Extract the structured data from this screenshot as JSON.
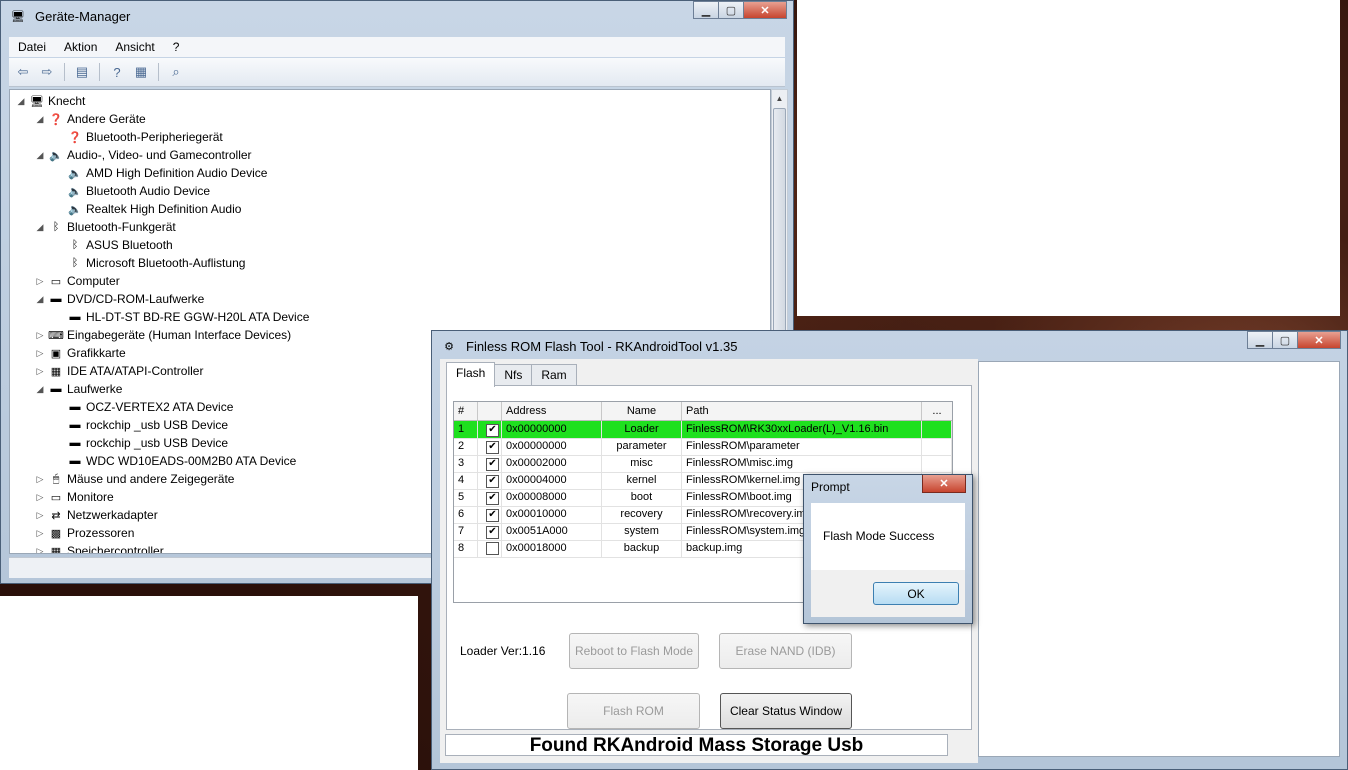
{
  "device_manager": {
    "title": "Geräte-Manager",
    "menu": [
      "Datei",
      "Aktion",
      "Ansicht",
      "?"
    ],
    "tree": [
      {
        "label": "Knecht",
        "level": 0,
        "expander": "◢",
        "icon": "computer-icon"
      },
      {
        "label": "Andere Geräte",
        "level": 1,
        "expander": "◢",
        "icon": "unknown-device-icon"
      },
      {
        "label": "Bluetooth-Peripheriegerät",
        "level": 2,
        "expander": "",
        "icon": "unknown-device-icon"
      },
      {
        "label": "Audio-, Video- und Gamecontroller",
        "level": 1,
        "expander": "◢",
        "icon": "speaker-icon"
      },
      {
        "label": "AMD High Definition Audio Device",
        "level": 2,
        "expander": "",
        "icon": "speaker-icon"
      },
      {
        "label": "Bluetooth Audio Device",
        "level": 2,
        "expander": "",
        "icon": "speaker-icon"
      },
      {
        "label": "Realtek High Definition Audio",
        "level": 2,
        "expander": "",
        "icon": "speaker-icon"
      },
      {
        "label": "Bluetooth-Funkgerät",
        "level": 1,
        "expander": "◢",
        "icon": "bluetooth-icon"
      },
      {
        "label": "ASUS Bluetooth",
        "level": 2,
        "expander": "",
        "icon": "bluetooth-icon"
      },
      {
        "label": "Microsoft Bluetooth-Auflistung",
        "level": 2,
        "expander": "",
        "icon": "bluetooth-icon"
      },
      {
        "label": "Computer",
        "level": 1,
        "expander": "▷",
        "icon": "monitor-icon"
      },
      {
        "label": "DVD/CD-ROM-Laufwerke",
        "level": 1,
        "expander": "◢",
        "icon": "drive-icon"
      },
      {
        "label": "HL-DT-ST BD-RE  GGW-H20L ATA Device",
        "level": 2,
        "expander": "",
        "icon": "drive-icon"
      },
      {
        "label": "Eingabegeräte (Human Interface Devices)",
        "level": 1,
        "expander": "▷",
        "icon": "hid-icon"
      },
      {
        "label": "Grafikkarte",
        "level": 1,
        "expander": "▷",
        "icon": "display-adapter-icon"
      },
      {
        "label": "IDE ATA/ATAPI-Controller",
        "level": 1,
        "expander": "▷",
        "icon": "controller-icon"
      },
      {
        "label": "Laufwerke",
        "level": 1,
        "expander": "◢",
        "icon": "drive-icon"
      },
      {
        "label": "OCZ-VERTEX2 ATA Device",
        "level": 2,
        "expander": "",
        "icon": "drive-icon"
      },
      {
        "label": "rockchip _usb USB Device",
        "level": 2,
        "expander": "",
        "icon": "drive-icon"
      },
      {
        "label": "rockchip _usb USB Device",
        "level": 2,
        "expander": "",
        "icon": "drive-icon"
      },
      {
        "label": "WDC WD10EADS-00M2B0 ATA Device",
        "level": 2,
        "expander": "",
        "icon": "drive-icon"
      },
      {
        "label": "Mäuse und andere Zeigegeräte",
        "level": 1,
        "expander": "▷",
        "icon": "mouse-icon"
      },
      {
        "label": "Monitore",
        "level": 1,
        "expander": "▷",
        "icon": "monitor-icon"
      },
      {
        "label": "Netzwerkadapter",
        "level": 1,
        "expander": "▷",
        "icon": "network-icon"
      },
      {
        "label": "Prozessoren",
        "level": 1,
        "expander": "▷",
        "icon": "cpu-icon"
      },
      {
        "label": "Speichercontroller",
        "level": 1,
        "expander": "▷",
        "icon": "controller-icon"
      }
    ]
  },
  "rktool": {
    "title": "Finless ROM Flash Tool - RKAndroidTool v1.35",
    "tabs": [
      "Flash",
      "Nfs",
      "Ram"
    ],
    "columns": [
      "#",
      "",
      "Address",
      "Name",
      "Path",
      "..."
    ],
    "rows": [
      {
        "num": "1",
        "checked": true,
        "address": "0x00000000",
        "name": "Loader",
        "path": "FinlessROM\\RK30xxLoader(L)_V1.16.bin",
        "highlight": true
      },
      {
        "num": "2",
        "checked": true,
        "address": "0x00000000",
        "name": "parameter",
        "path": "FinlessROM\\parameter",
        "highlight": false
      },
      {
        "num": "3",
        "checked": true,
        "address": "0x00002000",
        "name": "misc",
        "path": "FinlessROM\\misc.img",
        "highlight": false
      },
      {
        "num": "4",
        "checked": true,
        "address": "0x00004000",
        "name": "kernel",
        "path": "FinlessROM\\kernel.img",
        "highlight": false
      },
      {
        "num": "5",
        "checked": true,
        "address": "0x00008000",
        "name": "boot",
        "path": "FinlessROM\\boot.img",
        "highlight": false
      },
      {
        "num": "6",
        "checked": true,
        "address": "0x00010000",
        "name": "recovery",
        "path": "FinlessROM\\recovery.img",
        "highlight": false
      },
      {
        "num": "7",
        "checked": true,
        "address": "0x0051A000",
        "name": "system",
        "path": "FinlessROM\\system.img",
        "highlight": false
      },
      {
        "num": "8",
        "checked": false,
        "address": "0x00018000",
        "name": "backup",
        "path": "backup.img",
        "highlight": false
      }
    ],
    "loader_version": "Loader Ver:1.16",
    "buttons": {
      "reboot": "Reboot to Flash Mode",
      "erase": "Erase NAND (IDB)",
      "flash": "Flash ROM",
      "clear": "Clear Status Window"
    },
    "status": "Found RKAndroid Mass Storage Usb"
  },
  "prompt": {
    "title": "Prompt",
    "message": "Flash Mode Success",
    "ok": "OK"
  },
  "colors": {
    "highlight_row": "#1ee01e",
    "window_frame": "#b9c9dc",
    "close_button": "#c7452f"
  }
}
